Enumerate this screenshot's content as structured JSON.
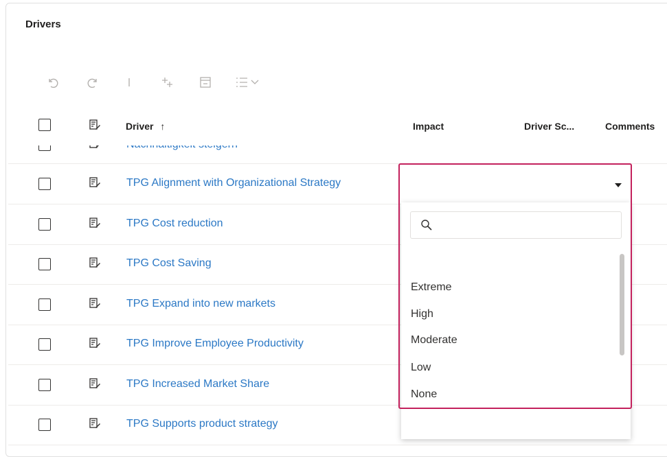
{
  "panel": {
    "title": "Drivers"
  },
  "toolbar": {
    "icons": [
      "undo-icon",
      "redo-icon",
      "separator",
      "add-row-icon",
      "collapse-icon",
      "view-options-icon",
      "chevron-down-icon"
    ]
  },
  "table": {
    "columns": {
      "driver": "Driver",
      "driver_sort": "↑",
      "impact": "Impact",
      "driver_score": "Driver Sc...",
      "comments": "Comments"
    },
    "partial_row": "Nachhaltigkeit steigern",
    "rows": [
      "TPG Alignment with Organizational Strategy",
      "TPG Cost reduction",
      "TPG Cost Saving",
      "TPG Expand into new markets",
      "TPG Improve Employee Productivity",
      "TPG Increased Market Share",
      "TPG Supports product strategy"
    ]
  },
  "impact_dropdown": {
    "selected": "",
    "search_value": "",
    "options": [
      "Extreme",
      "High",
      "Moderate",
      "Low",
      "None"
    ]
  },
  "colors": {
    "link": "#2b78c5",
    "highlight_border": "#c3205c",
    "toolbar_disabled": "#b3b0ad"
  }
}
